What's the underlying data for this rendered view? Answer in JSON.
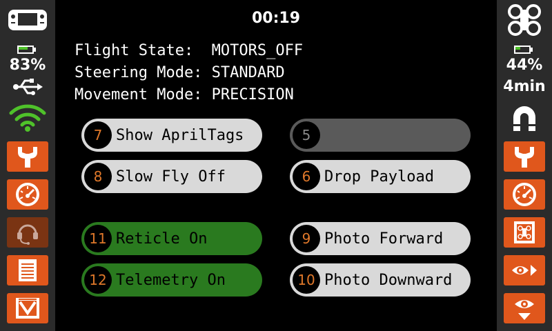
{
  "clock": "00:19",
  "status": {
    "flight_state": "Flight State:  MOTORS_OFF",
    "steering_mode": "Steering Mode: STANDARD",
    "movement_mode": "Movement Mode: PRECISION"
  },
  "left_panel": {
    "battery_percent": "83%",
    "battery_level": 0.83,
    "icons": [
      "controller-icon",
      "battery-icon",
      "usb-icon",
      "wifi-icon",
      "wrench-icon",
      "gauge-icon",
      "headset-icon",
      "document-icon",
      "inbox-icon"
    ]
  },
  "right_panel": {
    "battery_percent": "44%",
    "battery_level": 0.44,
    "flight_time": "4min",
    "icons": [
      "drone-icon",
      "battery-icon",
      "magnet-icon",
      "wrench-icon",
      "gauge-icon",
      "drone-config-icon",
      "eye-forward-icon",
      "eye-down-icon"
    ]
  },
  "buttons": [
    {
      "num": "7",
      "label": "Show AprilTags",
      "style": "light"
    },
    {
      "num": "5",
      "label": "",
      "style": "dark"
    },
    {
      "num": "8",
      "label": "Slow Fly Off",
      "style": "light"
    },
    {
      "num": "6",
      "label": "Drop Payload",
      "style": "light"
    },
    {
      "num": "11",
      "label": "Reticle On",
      "style": "green"
    },
    {
      "num": "9",
      "label": "Photo Forward",
      "style": "light"
    },
    {
      "num": "12",
      "label": "Telemetry On",
      "style": "green"
    },
    {
      "num": "10",
      "label": "Photo Downward",
      "style": "light"
    }
  ],
  "colors": {
    "accent": "#e0571c",
    "accent_dim": "#7a3413",
    "active_green": "#2a7a1f",
    "button_grey": "#d9d9d9",
    "button_disabled": "#5a5a5a",
    "number_orange": "#e0782a",
    "battery_green": "#4fc22a",
    "wifi_green": "#4fc22a"
  }
}
